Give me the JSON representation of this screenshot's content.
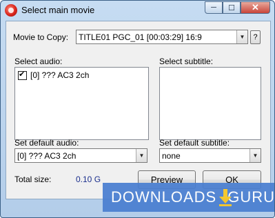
{
  "window": {
    "title": "Select main movie",
    "minimize": "─",
    "maximize": "☐",
    "close": "✕"
  },
  "movie": {
    "label": "Movie to Copy:",
    "value": "TITLE01 PGC_01 [00:03:29] 16:9",
    "help": "?"
  },
  "audio": {
    "label": "Select audio:",
    "items": [
      {
        "text": "[0] ??? AC3 2ch",
        "checked": true
      }
    ]
  },
  "subtitle": {
    "label": "Select subtitle:",
    "items": []
  },
  "default_audio": {
    "label": "Set default audio:",
    "value": "[0] ??? AC3 2ch"
  },
  "default_subtitle": {
    "label": "Set default subtitle:",
    "value": "none"
  },
  "total": {
    "label": "Total size:",
    "value": "0.10 G"
  },
  "buttons": {
    "preview": "Preview",
    "ok": "OK"
  },
  "watermark": {
    "left": "DOWNLOADS",
    "right": ".GURU"
  },
  "icons": {
    "combo_arrow": "chevron-down-icon",
    "check": "check-icon",
    "app": "app-icon"
  }
}
